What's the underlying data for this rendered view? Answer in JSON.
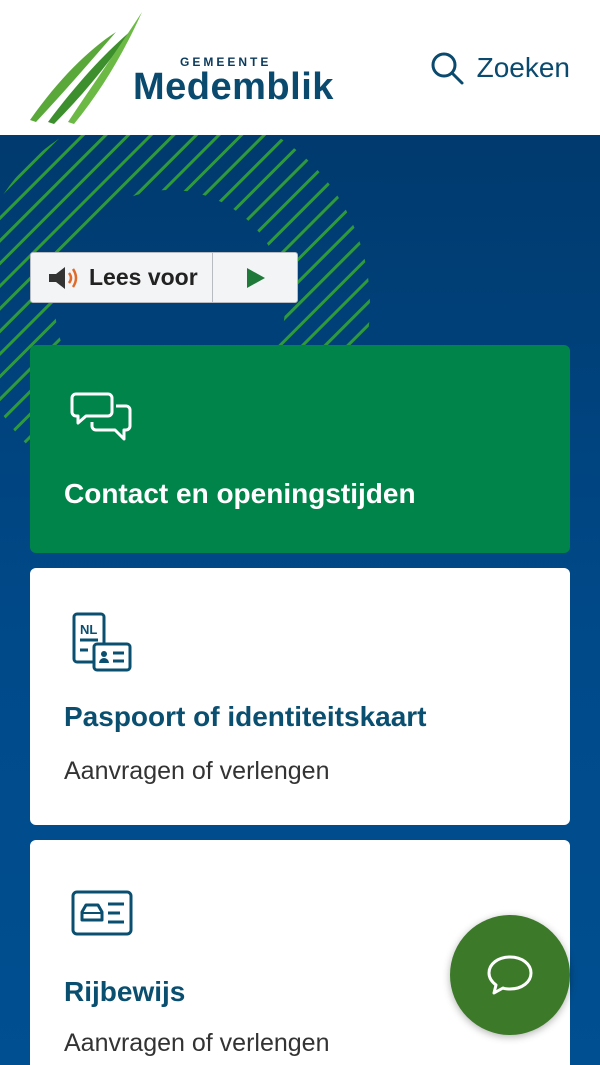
{
  "header": {
    "logo_small": "GEMEENTE",
    "logo_name": "Medemblik",
    "search_label": "Zoeken",
    "icons": {
      "search": "search-icon"
    }
  },
  "readspeaker": {
    "label": "Lees voor",
    "icons": {
      "speaker": "speaker-icon",
      "play": "play-icon"
    }
  },
  "cards": [
    {
      "title": "Contact en openingstijden",
      "subtitle": "",
      "icon": "chat-bubbles-icon"
    },
    {
      "title": "Paspoort of identiteitskaart",
      "subtitle": "Aanvragen of verlengen",
      "icon": "passport-id-icon"
    },
    {
      "title": "Rijbewijs",
      "subtitle": "Aanvragen of verlengen",
      "icon": "driving-license-icon"
    }
  ],
  "chat_button": {
    "icon": "chat-icon"
  },
  "colors": {
    "brand_blue": "#0a4a6e",
    "hero_blue": "#004a85",
    "contact_green": "#00844a",
    "chat_green": "#3c7a2a",
    "stripe_green": "#2e9a3a"
  }
}
